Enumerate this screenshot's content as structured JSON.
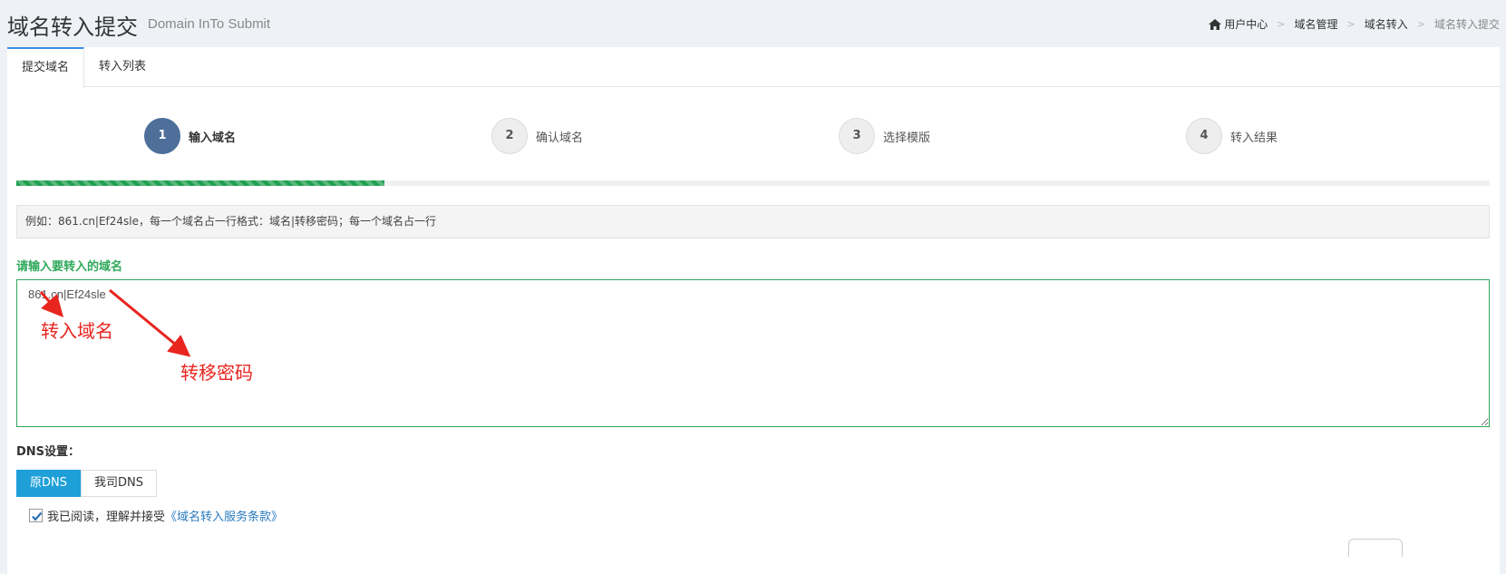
{
  "header": {
    "title": "域名转入提交",
    "subtitle": "Domain InTo Submit",
    "breadcrumb": [
      "用户中心",
      "域名管理",
      "域名转入",
      "域名转入提交"
    ],
    "breadcrumb_sep": ">"
  },
  "tabs": [
    {
      "label": "提交域名",
      "active": true
    },
    {
      "label": "转入列表",
      "active": false
    }
  ],
  "steps": [
    {
      "number": "1",
      "label": "输入域名",
      "active": true
    },
    {
      "number": "2",
      "label": "确认域名",
      "active": false
    },
    {
      "number": "3",
      "label": "选择模版",
      "active": false
    },
    {
      "number": "4",
      "label": "转入结果",
      "active": false
    }
  ],
  "progress": {
    "percent": 25
  },
  "hint": "例如：861.cn|Ef24sle，每一个域名占一行格式：域名|转移密码；每一个域名占一行",
  "domain_input": {
    "label": "请输入要转入的域名",
    "value": "861.cn|Ef24sle"
  },
  "annotations": {
    "domain": "转入域名",
    "password": "转移密码"
  },
  "dns": {
    "label": "DNS设置：",
    "options": [
      {
        "label": "原DNS",
        "active": true
      },
      {
        "label": "我司DNS",
        "active": false
      }
    ]
  },
  "agreement": {
    "checked": true,
    "text": "我已阅读，理解并接受",
    "link": "《域名转入服务条款》"
  },
  "colors": {
    "accent_green": "#2fa85a",
    "step_active": "#4d6f99",
    "dns_active": "#1e9fd8",
    "annotation_red": "#e8251f",
    "link_blue": "#2a7bbf"
  }
}
